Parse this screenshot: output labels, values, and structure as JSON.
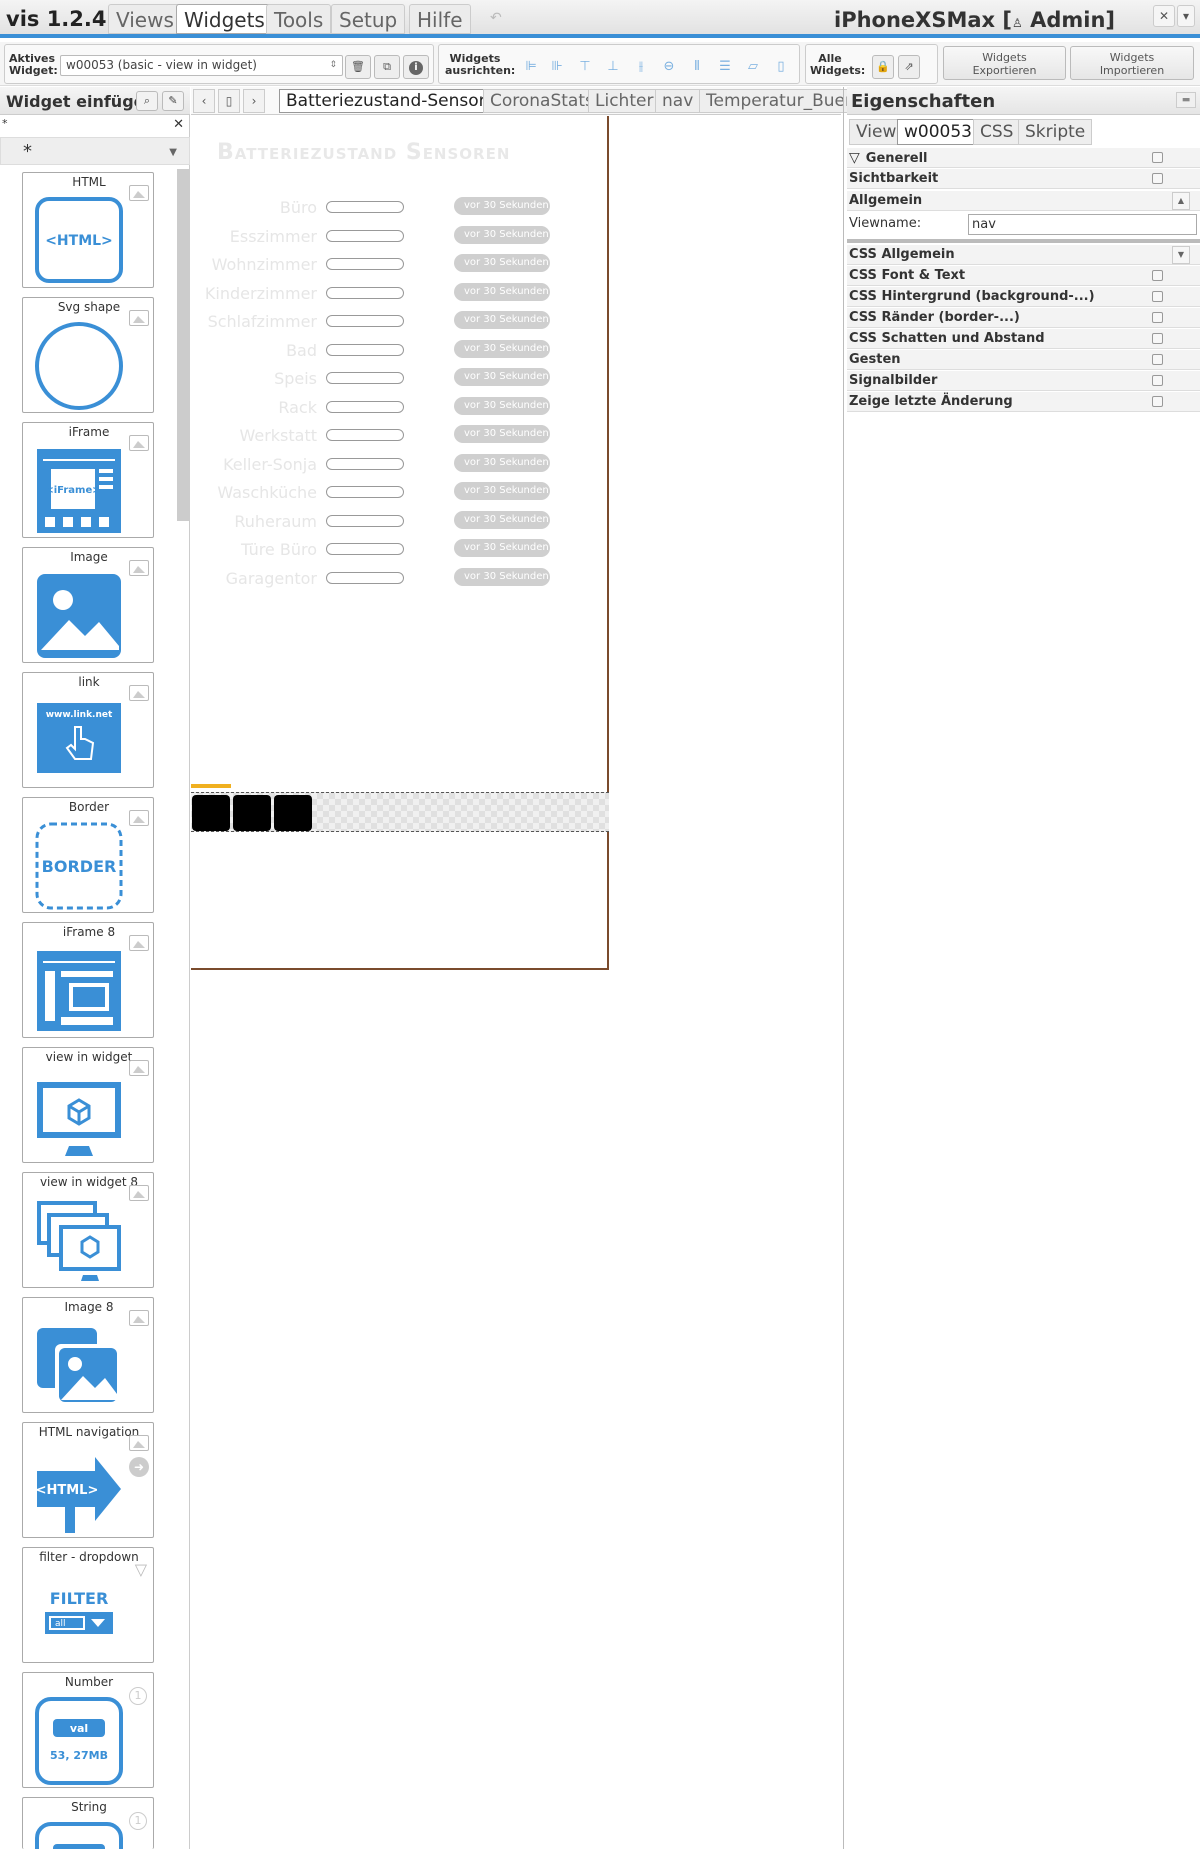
{
  "app": {
    "name": "vis 1.2.4",
    "project_title": "iPhoneXSMax",
    "user": "Admin"
  },
  "menu": [
    "Views",
    "Widgets",
    "Tools",
    "Setup",
    "Hilfe"
  ],
  "toolbar": {
    "active_widget_label_1": "Aktives",
    "active_widget_label_2": "Widget:",
    "active_widget_value": "w00053 (basic - view in widget)",
    "align_label_1": "Widgets",
    "align_label_2": "ausrichten:",
    "all_label_1": "Alle",
    "all_label_2": "Widgets:",
    "export_1": "Widgets",
    "export_2": "Exportieren",
    "import_1": "Widgets",
    "import_2": "Importieren"
  },
  "left_panel": {
    "title": "Widget einfügen",
    "search_value": "*",
    "filter_value": "*",
    "widgets": [
      "HTML",
      "Svg shape",
      "iFrame",
      "Image",
      "link",
      "Border",
      "iFrame 8",
      "view in widget",
      "view in widget 8",
      "Image 8",
      "HTML navigation",
      "filter - dropdown",
      "Number",
      "String"
    ],
    "icon_texts": {
      "html": "<HTML>",
      "iframe": "<iFrame>",
      "link": "www.link.net",
      "border": "BORDER",
      "filter": "FILTER",
      "filter_all": "all",
      "number_val": "val",
      "number_size": "53, 27MB"
    }
  },
  "view_tabs": [
    "Batteriezustand-Sensoren",
    "CoronaStats",
    "Lichter",
    "nav",
    "Temperatur_Buero"
  ],
  "canvas": {
    "title": "Batteriezustand Sensoren",
    "rows": [
      {
        "name": "Büro",
        "status": "vor 30 Sekunden"
      },
      {
        "name": "Esszimmer",
        "status": "vor 30 Sekunden"
      },
      {
        "name": "Wohnzimmer",
        "status": "vor 30 Sekunden"
      },
      {
        "name": "Kinderzimmer",
        "status": "vor 30 Sekunden"
      },
      {
        "name": "Schlafzimmer",
        "status": "vor 30 Sekunden"
      },
      {
        "name": "Bad",
        "status": "vor 30 Sekunden"
      },
      {
        "name": "Speis",
        "status": "vor 30 Sekunden"
      },
      {
        "name": "Rack",
        "status": "vor 30 Sekunden"
      },
      {
        "name": "Werkstatt",
        "status": "vor 30 Sekunden"
      },
      {
        "name": "Keller-Sonja",
        "status": "vor 30 Sekunden"
      },
      {
        "name": "Waschküche",
        "status": "vor 30 Sekunden"
      },
      {
        "name": "Ruheraum",
        "status": "vor 30 Sekunden"
      },
      {
        "name": "Türe Büro",
        "status": "vor 30 Sekunden"
      },
      {
        "name": "Garagentor",
        "status": "vor 30 Sekunden"
      }
    ]
  },
  "properties": {
    "title": "Eigenschaften",
    "tabs": [
      "View",
      "w00053",
      "CSS",
      "Skripte"
    ],
    "group_generell": "Generell",
    "group_sichtbarkeit": "Sichtbarkeit",
    "group_allgemein": "Allgemein",
    "viewname_label": "Viewname:",
    "viewname_value": "nav",
    "css_groups": [
      "CSS Allgemein",
      "CSS Font & Text",
      "CSS Hintergrund (background-...)",
      "CSS Ränder (border-...)",
      "CSS Schatten und Abstand",
      "Gesten",
      "Signalbilder",
      "Zeige letzte Änderung"
    ]
  },
  "colors": {
    "accent": "#3a8fd6",
    "icon_blue": "#3a8fd6",
    "selection": "#f0b020",
    "canvas_border": "#7a4b2d"
  }
}
